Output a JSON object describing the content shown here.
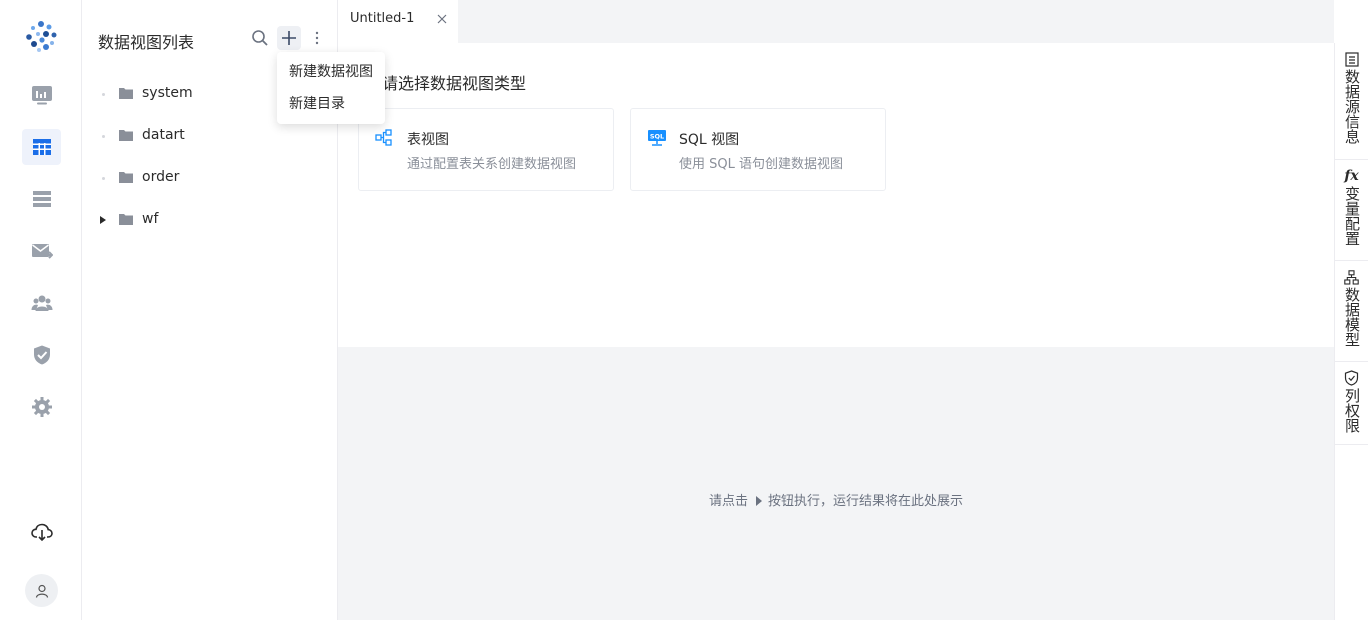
{
  "nav": {
    "icons": [
      "logo",
      "dashboard-icon",
      "dataview-icon",
      "datasource-icon",
      "schedule-icon",
      "members-icon",
      "permission-icon",
      "settings-icon",
      "download-icon",
      "user-avatar-icon"
    ],
    "active_color": "#1b6ee8"
  },
  "panel": {
    "title": "数据视图列表",
    "tree": [
      {
        "label": "system",
        "expandable": false
      },
      {
        "label": "datart",
        "expandable": false
      },
      {
        "label": "order",
        "expandable": false
      },
      {
        "label": "wf",
        "expandable": true
      }
    ]
  },
  "dropdown": {
    "items": [
      "新建数据视图",
      "新建目录"
    ]
  },
  "editor": {
    "tab_label": "Untitled-1",
    "section_title": "请选择数据视图类型",
    "cards": [
      {
        "title": "表视图",
        "desc": "通过配置表关系创建数据视图",
        "icon": "table-view-icon"
      },
      {
        "title": "SQL 视图",
        "desc": "使用 SQL 语句创建数据视图",
        "icon": "sql-view-icon"
      }
    ],
    "hint_before": "请点击",
    "hint_after": "按钮执行，运行结果将在此处展示"
  },
  "right_tabs": [
    {
      "label": "数据源信息",
      "icon": "list-icon"
    },
    {
      "label": "变量配置",
      "icon": "fx-icon",
      "icon_text": "fx"
    },
    {
      "label": "数据模型",
      "icon": "model-icon"
    },
    {
      "label": "列权限",
      "icon": "shield-check-icon"
    }
  ],
  "colors": {
    "accent": "#1b6ee8",
    "icon_gray": "#9aa1ab",
    "sql_blue": "#1890ff"
  }
}
